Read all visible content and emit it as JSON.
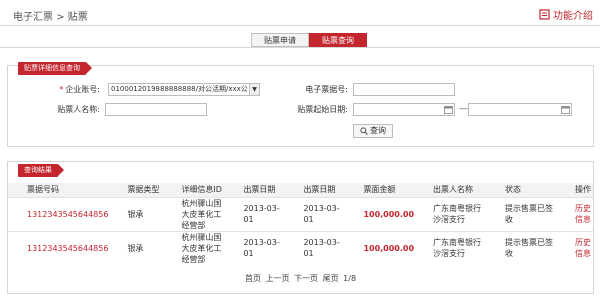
{
  "breadcrumb": {
    "parent": "电子汇票",
    "separator": ">",
    "current": "贴票"
  },
  "func_intro": "功能介绍",
  "tabs": [
    {
      "label": "贴票申请"
    },
    {
      "label": "贴票查询"
    }
  ],
  "query": {
    "title": "贴票详细信息查询",
    "account_label": "企业账号:",
    "account_value": "0100012019888888888/对公活期/xxx公",
    "bill_no_label": "电子票据号:",
    "bill_no_value": "",
    "payee_label": "贴票人名称:",
    "payee_value": "",
    "date_label": "贴票起始日期:",
    "date_start": "",
    "date_end": "",
    "date_sep": "—",
    "button": "查询"
  },
  "result": {
    "title": "查询结果",
    "columns": [
      "票据号码",
      "票据类型",
      "详细信息ID",
      "出票日期",
      "出票日期",
      "票面金额",
      "出票人名称",
      "状态",
      "操作"
    ],
    "rows": [
      {
        "bill_no": "1312343545644856",
        "type": "银承",
        "detail": "杭州骤山国大皮革化工经营部",
        "issue_date": "2013-03-01",
        "due_date": "2013-03-01",
        "amount": "100,000.00",
        "drawer": "广东南粤银行沙滘支行",
        "status": "提示售票已签收",
        "action": "历史信息"
      },
      {
        "bill_no": "1312343545644856",
        "type": "银承",
        "detail": "杭州骤山国大皮革化工经营部",
        "issue_date": "2013-03-01",
        "due_date": "2013-03-01",
        "amount": "100,000.00",
        "drawer": "广东南粤银行沙滘支行",
        "status": "提示售票已签收",
        "action": "历史信息"
      }
    ],
    "pager": {
      "first": "首页",
      "prev": "上一页",
      "next": "下一页",
      "last": "尾页",
      "page": "1/8"
    }
  },
  "colors": {
    "accent": "#c4262e"
  }
}
